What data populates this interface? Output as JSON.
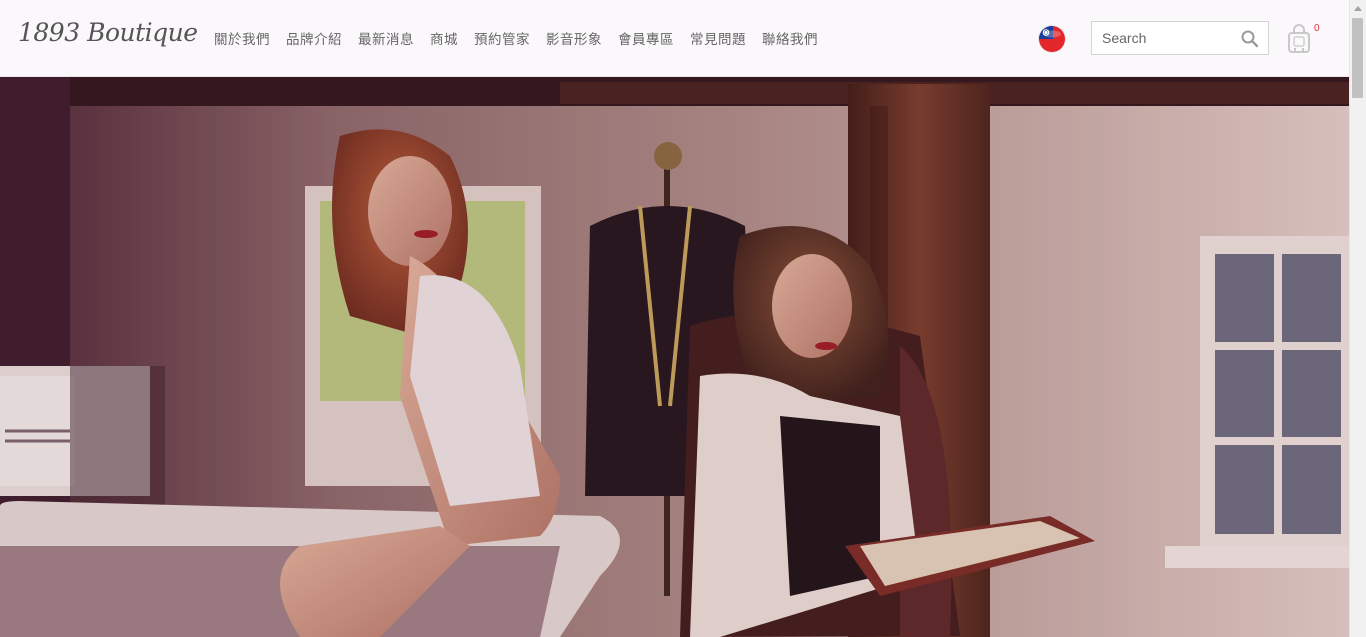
{
  "header": {
    "logo_text": "1893 Boutique",
    "nav": [
      {
        "label": "關於我們"
      },
      {
        "label": "品牌介紹"
      },
      {
        "label": "最新消息"
      },
      {
        "label": "商城"
      },
      {
        "label": "預約管家"
      },
      {
        "label": "影音形象"
      },
      {
        "label": "會員專區"
      },
      {
        "label": "常見問題"
      },
      {
        "label": "聯絡我們"
      }
    ],
    "language_icon": "taiwan-flag-icon",
    "search": {
      "placeholder": "Search",
      "value": "",
      "icon": "search-icon"
    },
    "cart": {
      "icon": "shopping-bag-icon",
      "count": "0"
    }
  },
  "hero": {
    "slide_count": 3,
    "active_slide": 1
  },
  "colors": {
    "header_bg": "#fbf8fb",
    "nav_text": "#666666",
    "cart_count": "#e0303a",
    "hero_tone": "#6b3a3f"
  }
}
